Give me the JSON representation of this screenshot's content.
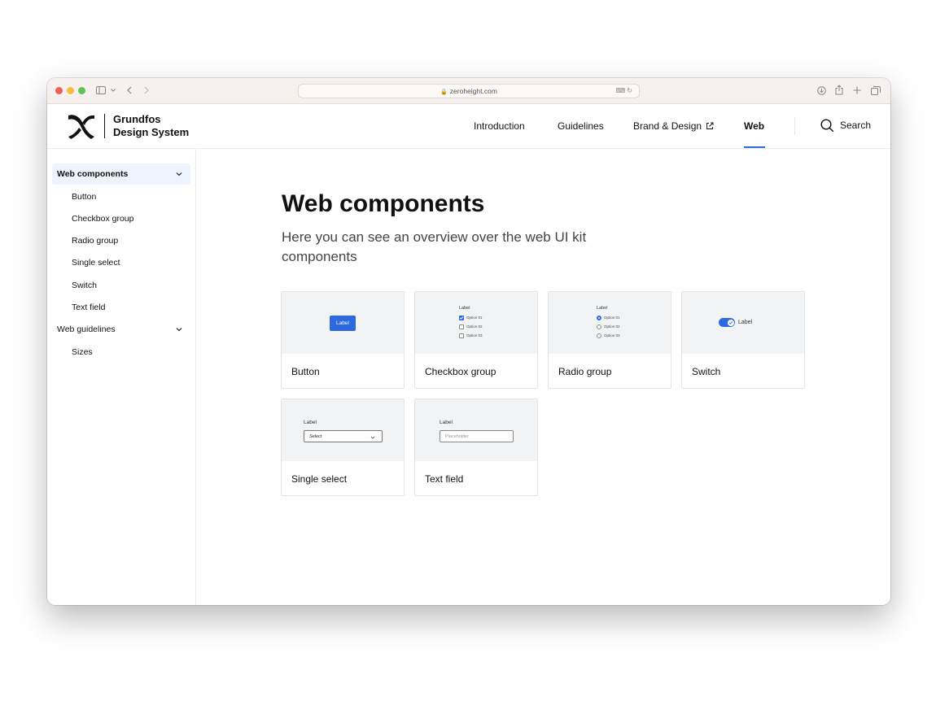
{
  "browser": {
    "url": "zeroheight.com",
    "colors": {
      "close": "#ee5f57",
      "minimize": "#f5bd3f",
      "zoom": "#5fc454"
    },
    "icons": [
      "sidebar-toggle-icon",
      "chevron-down-icon",
      "back-icon",
      "forward-icon",
      "lock-icon",
      "translate-icon",
      "reload-icon",
      "download-icon",
      "share-icon",
      "new-tab-icon",
      "tab-overview-icon"
    ]
  },
  "header": {
    "logo_line1": "Grundfos",
    "logo_line2": "Design System",
    "nav": [
      {
        "label": "Introduction"
      },
      {
        "label": "Guidelines"
      },
      {
        "label": "Brand & Design"
      },
      {
        "label": "Web"
      }
    ],
    "active_nav": "Web",
    "search_label": "Search",
    "accent_color": "#2d6ae0"
  },
  "sidebar": {
    "groups": [
      {
        "label": "Web components",
        "items": [
          "Button",
          "Checkbox group",
          "Radio group",
          "Single select",
          "Switch",
          "Text field"
        ]
      },
      {
        "label": "Web guidelines",
        "items": [
          "Sizes"
        ]
      }
    ]
  },
  "main": {
    "title": "Web components",
    "subtitle": "Here you can see an overview over the web UI kit components",
    "cards": [
      {
        "title": "Button",
        "preview": {
          "button_label": "Label"
        }
      },
      {
        "title": "Checkbox group",
        "preview": {
          "label": "Label",
          "options": [
            "Option 01",
            "Option 02",
            "Option 03"
          ],
          "checked_index": 0
        }
      },
      {
        "title": "Radio group",
        "preview": {
          "label": "Label",
          "options": [
            "Option 01",
            "Option 02",
            "Option 03"
          ],
          "selected_index": 0
        }
      },
      {
        "title": "Switch",
        "preview": {
          "label": "Label",
          "on": true
        }
      },
      {
        "title": "Single select",
        "preview": {
          "label": "Label",
          "value": "Select"
        }
      },
      {
        "title": "Text field",
        "preview": {
          "label": "Label",
          "placeholder": "Placeholder"
        }
      }
    ]
  }
}
